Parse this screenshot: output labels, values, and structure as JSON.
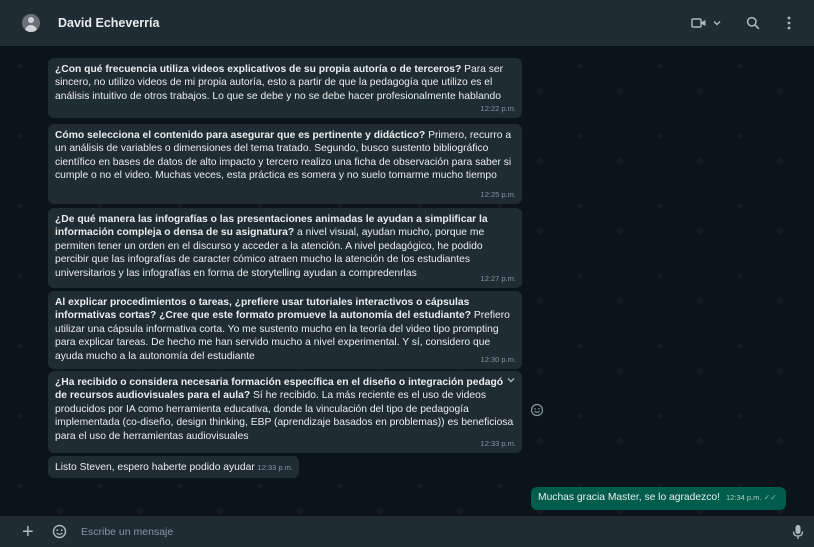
{
  "header": {
    "contact_name": "David Echeverría",
    "icons": [
      "avatar-icon",
      "video-call-icon",
      "chevron-down-icon",
      "search-icon",
      "menu-icon"
    ]
  },
  "messages": [
    {
      "bold": "¿Con qué frecuencia utiliza videos explicativos de su propia autoría o de terceros?",
      "text": " Para ser sincero, no utilizo videos de mi propia autoría, esto a partir de que la pedagogía que utilizo es el análisis intuitivo de otros trabajos. Lo que se debe y no se debe hacer profesionalmente hablando",
      "time": "12:22 p.m."
    },
    {
      "bold": "Cómo selecciona el contenido para asegurar que es pertinente y didáctico?",
      "text": " Primero, recurro a un análisis de variables o dimensiones del tema tratado. Segundo, busco sustento bibliográfico científico en bases de datos de alto impacto y tercero realizo una ficha de observación para saber si cumple o no el video. Muchas veces, esta práctica es somera y no suelo tomarme mucho tiempo",
      "time": "12:25 p.m."
    },
    {
      "bold": "¿De qué manera las infografías o las presentaciones animadas le ayudan a simplificar la información compleja o densa de su asignatura?",
      "text": " a nivel visual, ayudan mucho, porque me permiten tener un orden en el discurso y acceder a la atención. A nivel pedagógico, he podido percibir que las infografías de caracter cómico atraen mucho la atención de los estudiantes universitarios  y las infografías en forma de storytelling ayudan a compredenrlas",
      "time": "12:27 p.m."
    },
    {
      "bold": "Al explicar procedimientos o tareas, ¿prefiere usar tutoriales interactivos o cápsulas informativas cortas? ¿Cree que este formato promueve la autonomía del estudiante?",
      "text": " Prefiero utilizar una cápsula informativa corta. Yo me sustento mucho en la teoría del video tipo prompting para explicar tareas. De hecho me han servido mucho a nivel experimental. Y sí, considero que ayuda mucho a la autonomía del estudiante",
      "time": "12:30 p.m."
    },
    {
      "bold": "¿Ha recibido o considera necesaria formación específica en el diseño o integración pedagó de recursos audiovisuales para el aula?",
      "text": " Sí he recibido. La más reciente es el uso de videos producidos por IA como herramienta educativa, donde la vinculación del tipo de pedagogía implementada (co-diseño, design thinking, EBP (aprendizaje basados en problemas)) es beneficiosa para el uso de herramientas audiovisuales",
      "time": "12:33 p.m."
    },
    {
      "bold": "",
      "text": "Listo Steven, espero haberte podido ayudar",
      "time": "12:33 p.m."
    }
  ],
  "outgoing": {
    "text": "Muchas gracia Master, se lo agradezco!",
    "time": "12:34 p.m."
  },
  "footer": {
    "placeholder": "Escribe un mensaje"
  }
}
